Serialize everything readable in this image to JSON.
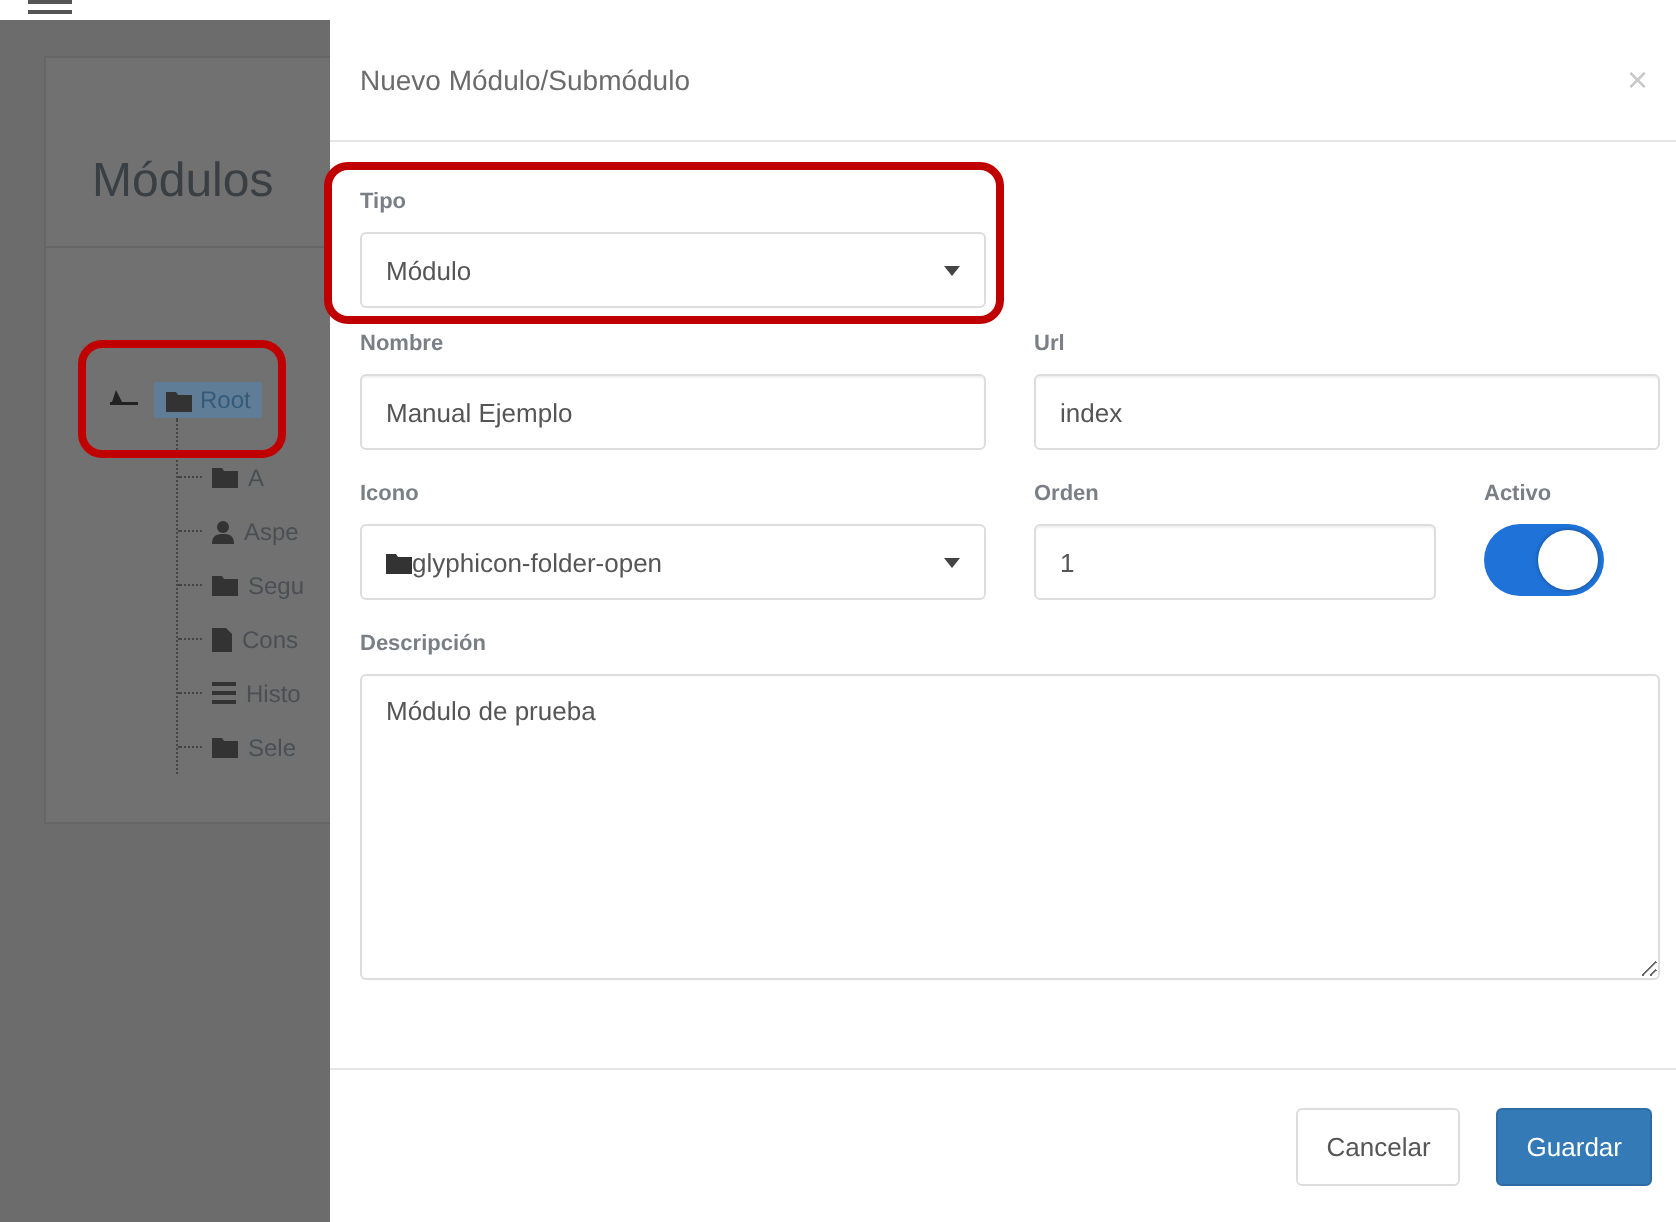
{
  "page": {
    "title": "Módulos",
    "tree": {
      "label": "Root",
      "selected": true,
      "expanded": true,
      "children": [
        {
          "label": "A",
          "kind": "folder"
        },
        {
          "label": "Aspe",
          "kind": "user"
        },
        {
          "label": "Segu",
          "kind": "folder"
        },
        {
          "label": "Cons",
          "kind": "file"
        },
        {
          "label": "Histo",
          "kind": "list"
        },
        {
          "label": "Sele",
          "kind": "folder"
        }
      ]
    }
  },
  "modal": {
    "title": "Nuevo Módulo/Submódulo",
    "close": "×",
    "tipo": {
      "label": "Tipo",
      "value": "Módulo"
    },
    "nombre": {
      "label": "Nombre",
      "value": "Manual Ejemplo"
    },
    "url": {
      "label": "Url",
      "value": "index"
    },
    "icono": {
      "label": "Icono",
      "value": "glyphicon-folder-open"
    },
    "orden": {
      "label": "Orden",
      "value": "1"
    },
    "activo": {
      "label": "Activo",
      "on": true
    },
    "descripcion": {
      "label": "Descripción",
      "value": "Módulo de prueba"
    },
    "buttons": [
      {
        "label": "Cancelar",
        "kind": "default"
      },
      {
        "label": "Guardar",
        "kind": "primary"
      }
    ]
  }
}
